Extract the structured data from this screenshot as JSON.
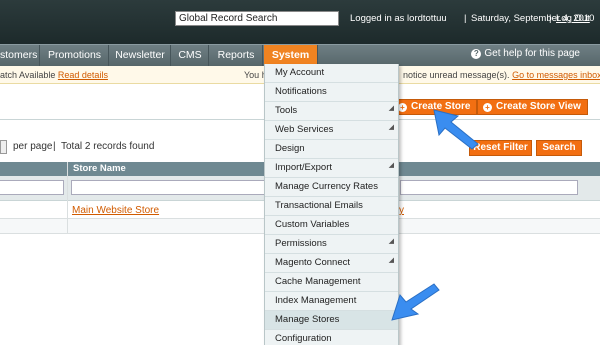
{
  "header": {
    "search_value": "Global Record Search",
    "logged_in": "Logged in as lordtottuu",
    "separator": "|",
    "date": "Saturday, September 4, 2010",
    "logout": "Log Out"
  },
  "nav": {
    "items": [
      "stomers",
      "Promotions",
      "Newsletter",
      "CMS",
      "Reports",
      "System"
    ],
    "help": "Get help for this page"
  },
  "notice": {
    "left_text": "atch Available",
    "left_link": "Read details",
    "mid_text": "You h",
    "right_text": "notice unread message(s).",
    "right_link": "Go to messages inbox"
  },
  "buttons": {
    "create_store": "Create Store",
    "create_store_view": "Create Store View",
    "reset_filter": "Reset Filter",
    "search": "Search"
  },
  "pager": {
    "per_page": "per page",
    "sep": "|",
    "total": "Total 2 records found"
  },
  "grid": {
    "header_store_name": "Store Name",
    "row1_store": "Main Website Store",
    "row1_tail": "y"
  },
  "system_menu": [
    "My Account",
    "Notifications",
    "Tools",
    "Web Services",
    "Design",
    "Import/Export",
    "Manage Currency Rates",
    "Transactional Emails",
    "Custom Variables",
    "Permissions",
    "Magento Connect",
    "Cache Management",
    "Index Management",
    "Manage Stores",
    "Configuration"
  ],
  "colors": {
    "accent_orange": "#f26f12",
    "header_dark": "#2c3b3c",
    "pointer_blue": "#3a8df0"
  }
}
